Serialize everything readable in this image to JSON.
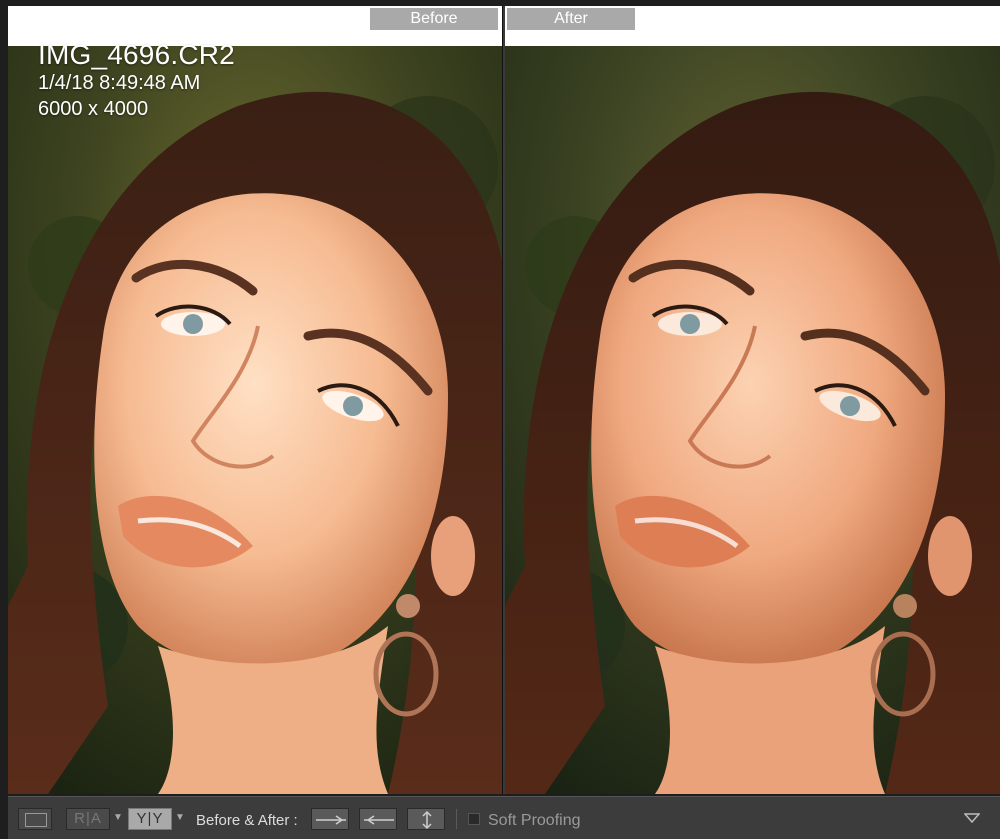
{
  "panes": {
    "before_label": "Before",
    "after_label": "After"
  },
  "photo_info": {
    "filename": "IMG_4696.CR2",
    "datetime": "1/4/18 8:49:48 AM",
    "dimensions": "6000 x 4000"
  },
  "toolbar": {
    "ra_label": "R|A",
    "yy_label": "Y|Y",
    "before_after_label": "Before & After :",
    "soft_proofing_label": "Soft Proofing"
  },
  "colors": {
    "before_tone": "#f2b894",
    "after_tone": "#f0a980",
    "toolbar_bg": "#3c3c3c",
    "tag_bg": "#a9a9a9"
  },
  "icons": [
    "loupe-view-icon",
    "chevron-down-icon",
    "copy-before-to-after-icon",
    "copy-after-to-before-icon",
    "swap-icon",
    "toolbar-menu-icon"
  ]
}
